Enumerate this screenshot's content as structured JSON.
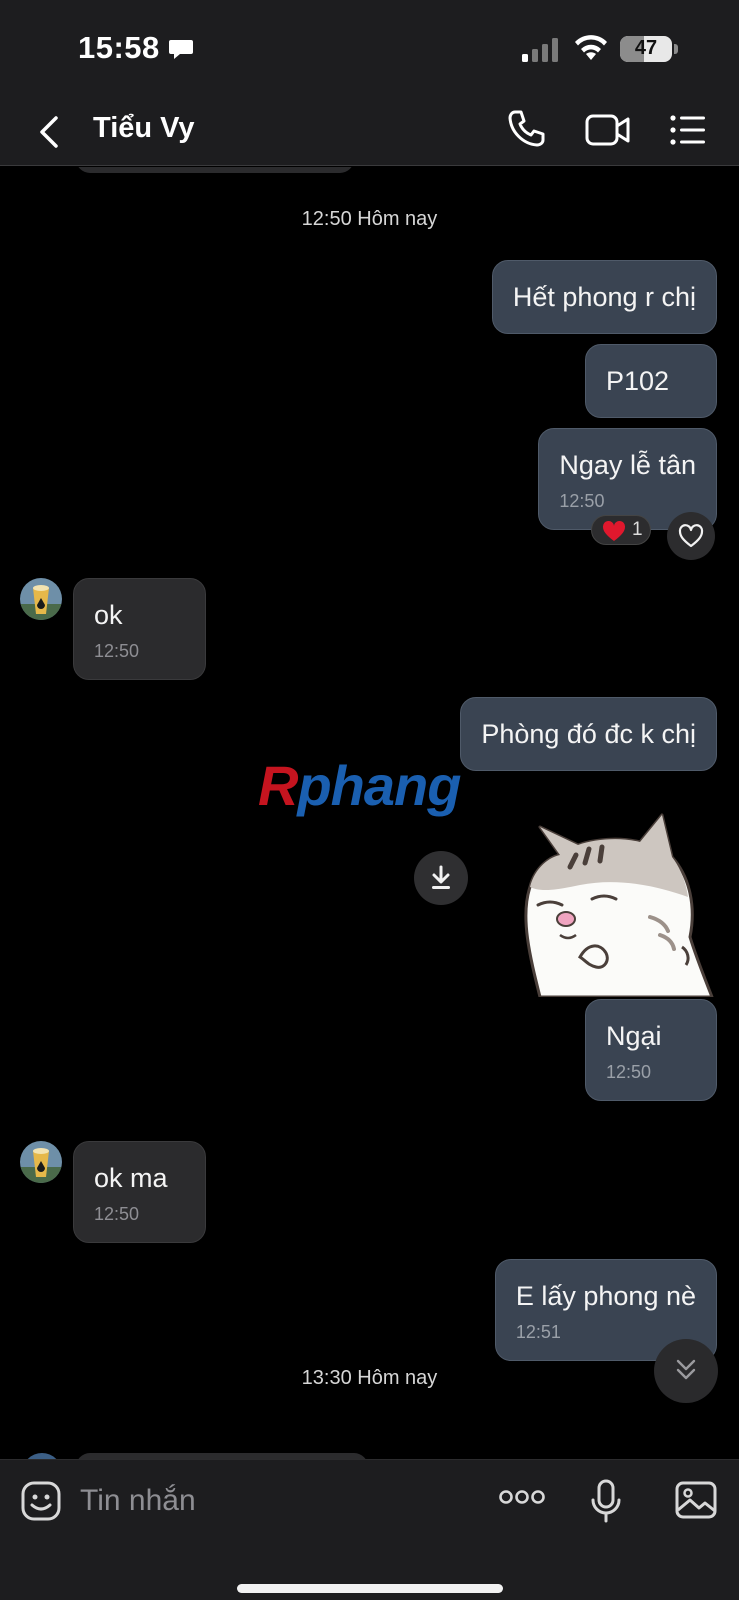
{
  "status_bar": {
    "time": "15:58",
    "battery": "47",
    "battery_level": 0.47
  },
  "header": {
    "contact_name": "Tiểu Vy",
    "back_icon": "chevron-left-icon",
    "call_icon": "phone-icon",
    "video_icon": "video-camera-icon",
    "menu_icon": "list-icon"
  },
  "chat": {
    "date_separators": [
      "12:50 Hôm nay",
      "13:30 Hôm nay"
    ],
    "messages": [
      {
        "direction": "out",
        "text": "Hết phong r chị"
      },
      {
        "direction": "out",
        "text": "P102"
      },
      {
        "direction": "out",
        "text": "Ngay lễ tân",
        "time": "12:50",
        "reaction": {
          "emoji": "heart",
          "count": "1"
        }
      },
      {
        "direction": "in",
        "text": "ok",
        "time": "12:50"
      },
      {
        "direction": "out",
        "text": "Phòng đó đc k chị"
      },
      {
        "direction": "out",
        "type": "sticker",
        "sticker": "cat-sticker"
      },
      {
        "direction": "out",
        "text": "Ngại",
        "time": "12:50"
      },
      {
        "direction": "in",
        "text": "ok ma",
        "time": "12:50"
      },
      {
        "direction": "out",
        "text": "E lấy phong nè",
        "time": "12:51"
      }
    ],
    "watermark": {
      "first": "R",
      "rest": "phang"
    }
  },
  "input_bar": {
    "placeholder": "Tin nhắn"
  },
  "colors": {
    "outgoing_bubble": "#3a4452",
    "incoming_bubble": "#2b2b2d",
    "background": "#000000",
    "bar": "#1d1d1f"
  }
}
